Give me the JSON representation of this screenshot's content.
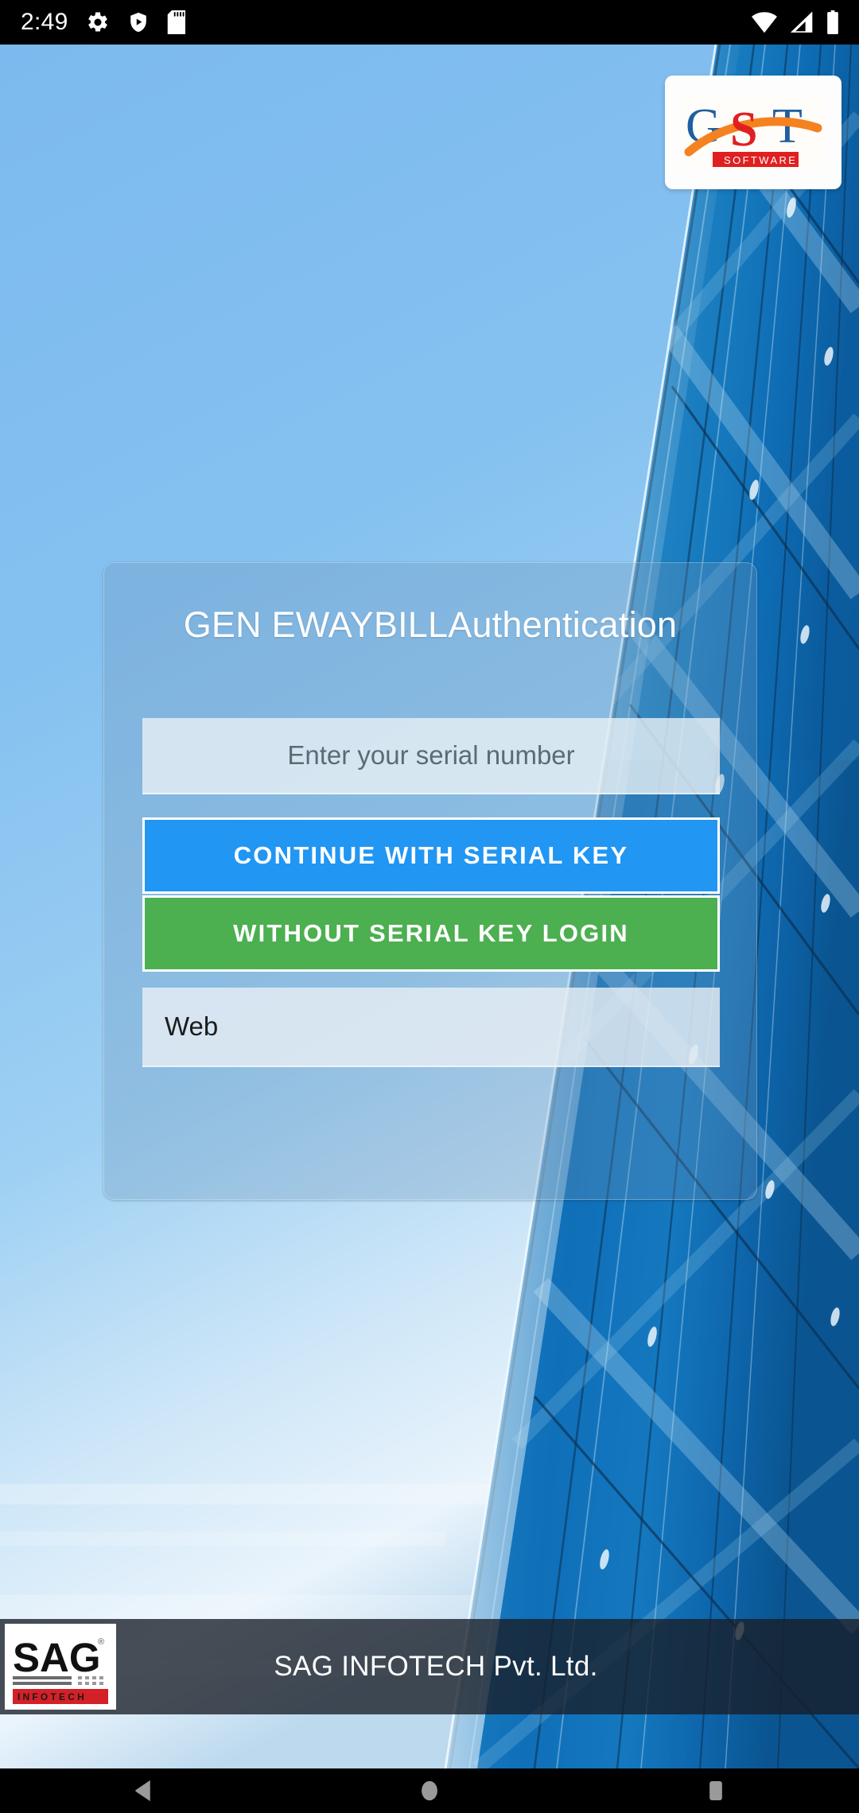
{
  "status_bar": {
    "clock": "2:49",
    "left_icons": [
      "gear-icon",
      "play-protect-shield-icon",
      "sd-card-icon"
    ],
    "right_icons": [
      "wifi-icon",
      "cell-signal-icon",
      "battery-icon"
    ],
    "background": "#000000"
  },
  "header": {
    "logo": {
      "name": "gst-software-logo",
      "letters": [
        "G",
        "S",
        "T"
      ],
      "tagline": "SOFTWARE",
      "colors": {
        "g_and_t": "#1f5fa0",
        "s": "#e02020",
        "swoosh": "#f58220",
        "tagline_bar": "#e02020"
      }
    }
  },
  "auth_card": {
    "title": "GEN EWAYBILLAuthentication",
    "serial_input": {
      "placeholder": "Enter your serial number",
      "value": ""
    },
    "continue_button": {
      "label": "CONTINUE WITH SERIAL KEY",
      "color": "#2196F3"
    },
    "without_key_button": {
      "label": "WITHOUT SERIAL KEY LOGIN",
      "color": "#4CAF50"
    },
    "web_field": {
      "value": "Web",
      "placeholder": "Web"
    }
  },
  "brand_bar": {
    "company": "SAG INFOTECH Pvt. Ltd.",
    "logo": {
      "name": "sag-infotech-logo",
      "wordmark": "SAG",
      "subtext": "INFOTECH"
    }
  },
  "nav_bar": {
    "back": "back-button",
    "home": "home-button",
    "recents": "recents-button"
  }
}
